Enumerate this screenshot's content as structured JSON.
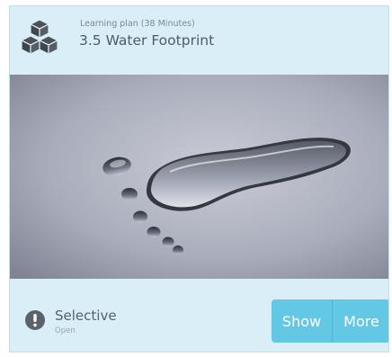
{
  "card": {
    "icon": "cubes-icon",
    "subtitle": "Learning plan (38 Minutes)",
    "title": "3.5 Water Footprint",
    "image": "water-footprint-image",
    "status": {
      "icon": "exclamation-circle-icon",
      "label": "Selective",
      "sublabel": "Open"
    },
    "buttons": {
      "show_label": "Show",
      "more_label": "More"
    },
    "colors": {
      "card_background": "#d9eef6",
      "button": "#63c8e4",
      "icon": "#4a5258"
    }
  }
}
